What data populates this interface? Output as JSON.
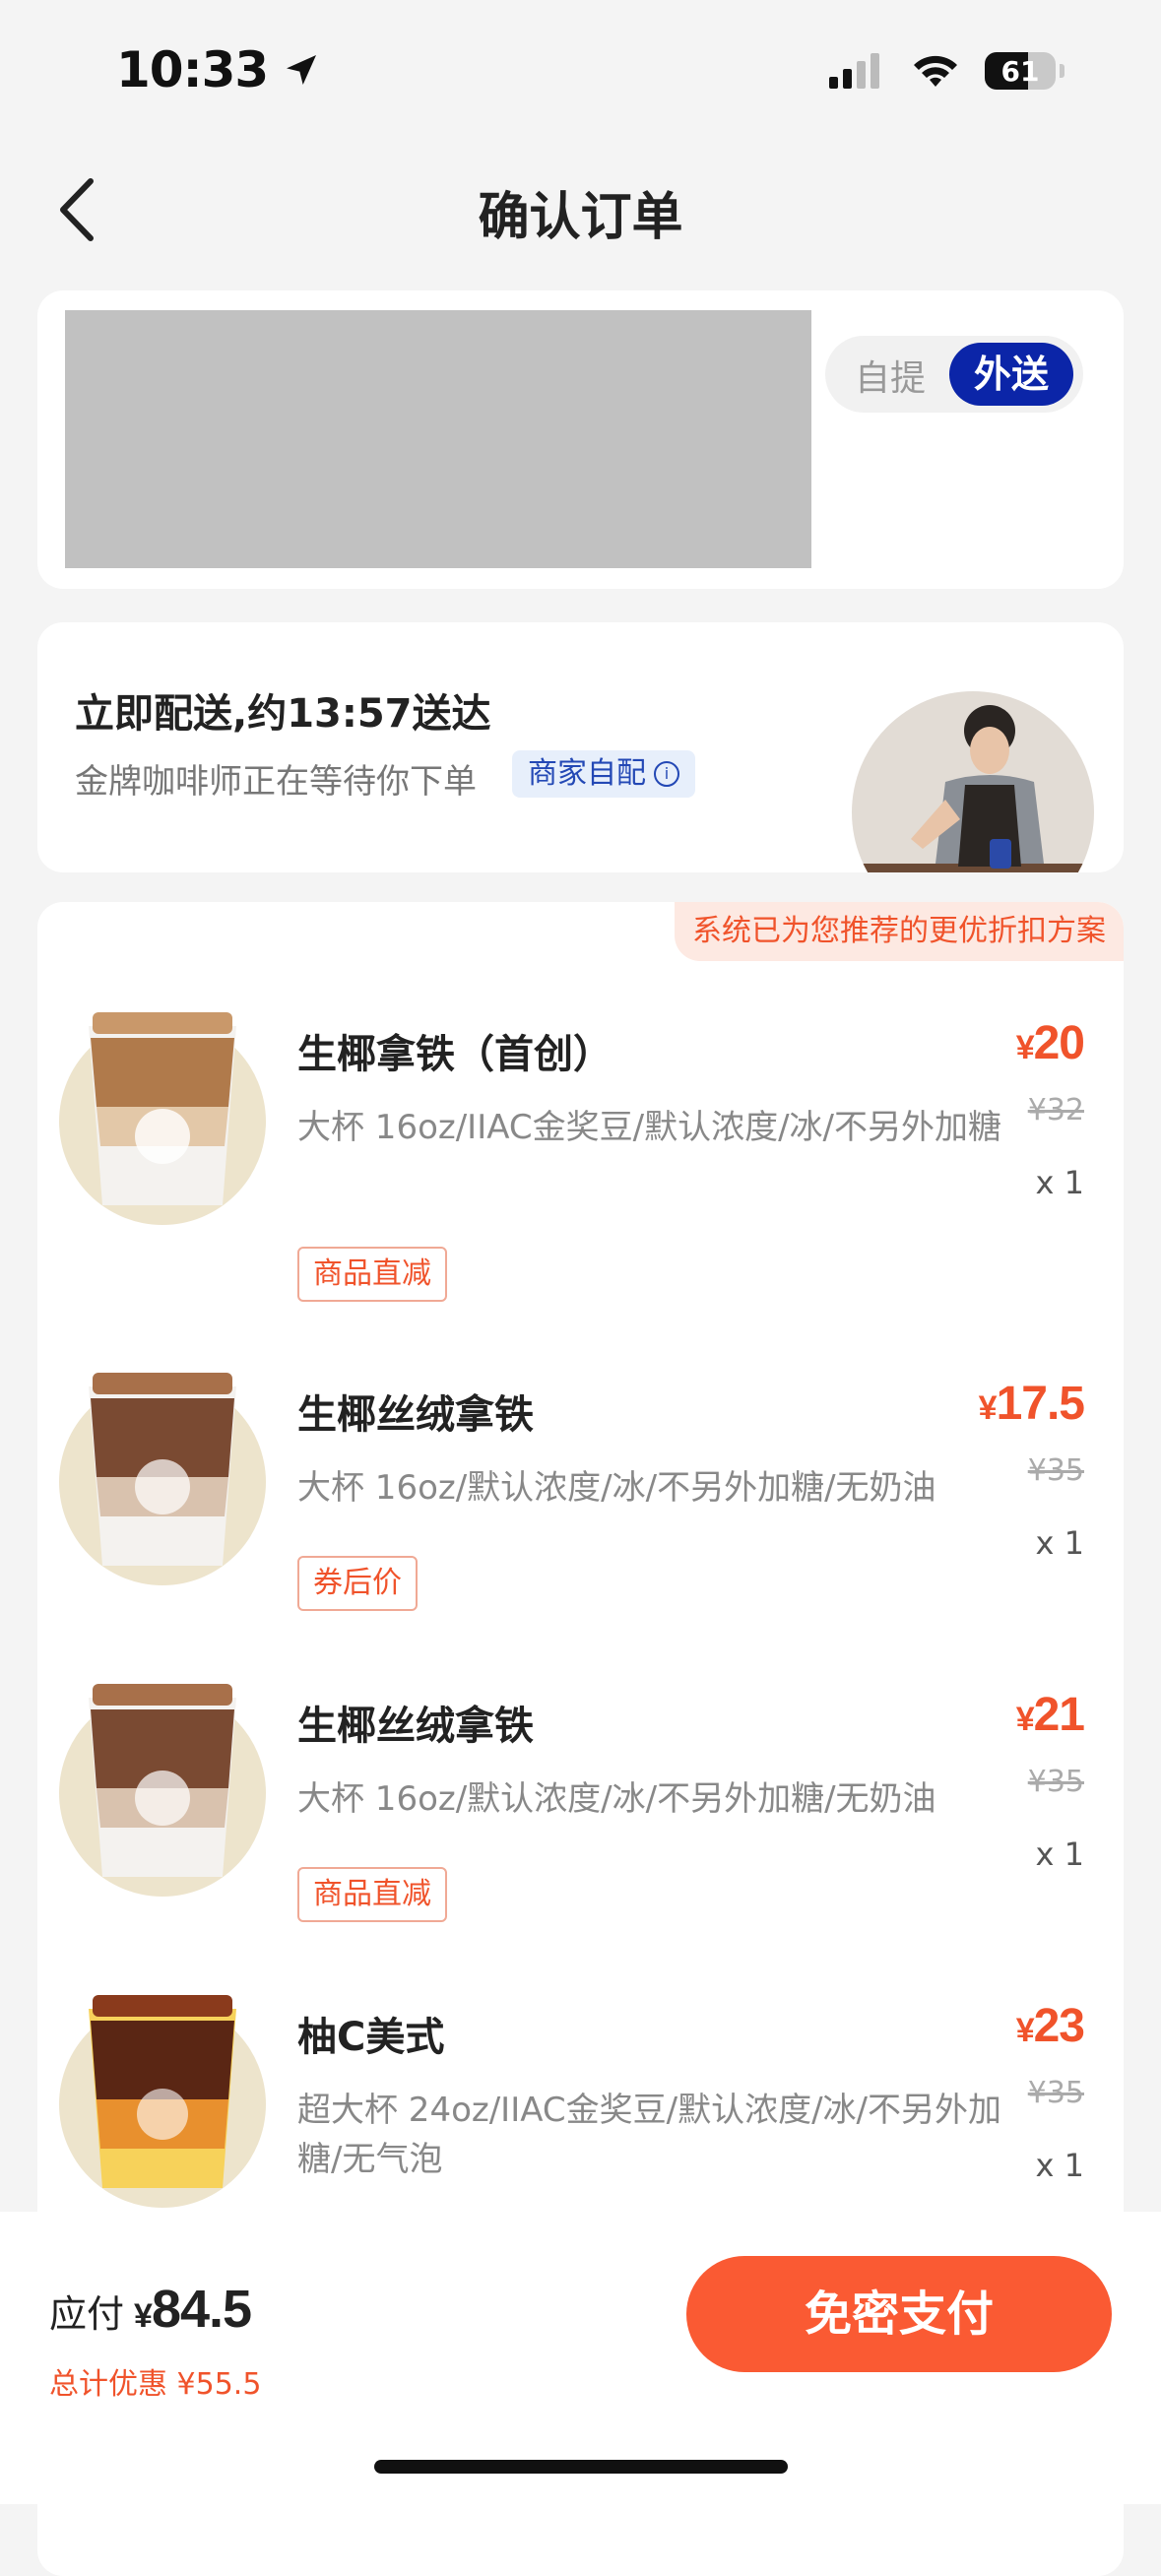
{
  "status_bar": {
    "time": "10:33",
    "battery": "61"
  },
  "header": {
    "title": "确认订单"
  },
  "address_card": {
    "mode_pickup": "自提",
    "mode_delivery": "外送"
  },
  "delivery": {
    "title": "立即配送,约13:57送达",
    "subtitle": "金牌咖啡师正在等待你下单",
    "merchant_tag": "商家自配"
  },
  "items_section": {
    "promo": "系统已为您推荐的更优折扣方案",
    "items": [
      {
        "name": "生椰拿铁（首创）",
        "spec": "大杯 16oz/IIAC金奖豆/默认浓度/冰/不另外加糖",
        "tag": "商品直减",
        "currency": "¥",
        "price": "20",
        "original": "¥32",
        "qty": "x 1"
      },
      {
        "name": "生椰丝绒拿铁",
        "spec": "大杯 16oz/默认浓度/冰/不另外加糖/无奶油",
        "tag": "券后价",
        "currency": "¥",
        "price": "17.5",
        "original": "¥35",
        "qty": "x 1"
      },
      {
        "name": "生椰丝绒拿铁",
        "spec": "大杯 16oz/默认浓度/冰/不另外加糖/无奶油",
        "tag": "商品直减",
        "currency": "¥",
        "price": "21",
        "original": "¥35",
        "qty": "x 1"
      },
      {
        "name": "柚C美式",
        "spec": "超大杯 24oz/IIAC金奖豆/默认浓度/冰/不另外加糖/无气泡",
        "tag": "",
        "currency": "¥",
        "price": "23",
        "original": "¥35",
        "qty": "x 1"
      }
    ]
  },
  "footer": {
    "due_label": "应付",
    "due_currency": "¥",
    "due_amount": "84.5",
    "saving": "总计优惠 ¥55.5",
    "pay_button": "免密支付"
  },
  "colors": {
    "accent": "#fa5a33",
    "brand_blue": "#0b25a8",
    "price_red": "#f0532b"
  },
  "icons": [
    "location-arrow-icon",
    "signal-icon",
    "wifi-icon",
    "battery-icon",
    "back-chevron-icon",
    "info-icon"
  ]
}
